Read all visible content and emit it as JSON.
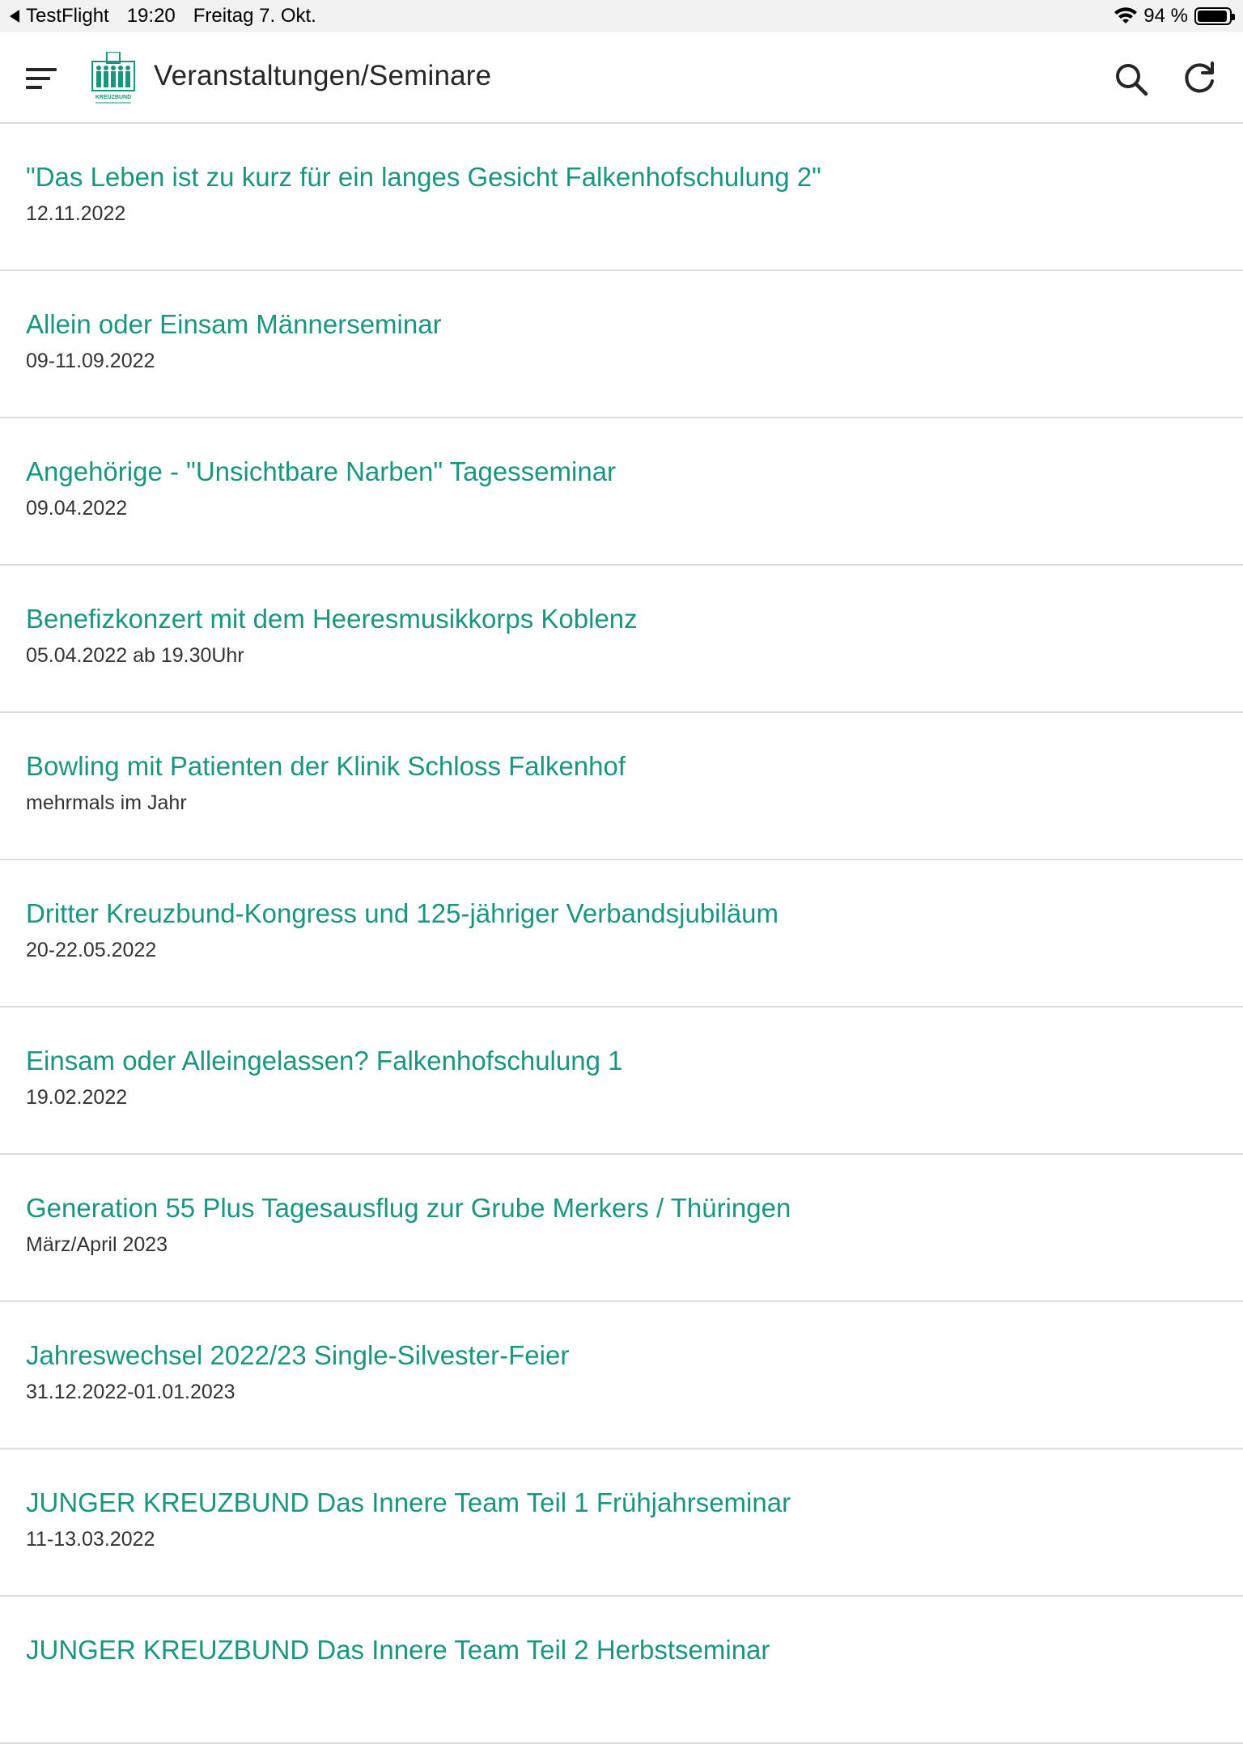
{
  "status_bar": {
    "app": "TestFlight",
    "time": "19:20",
    "date": "Freitag 7. Okt.",
    "battery": "94 %",
    "battery_level": 0.94
  },
  "app_bar": {
    "title": "Veranstaltungen/Seminare",
    "logo_text": "KREUZBUND"
  },
  "colors": {
    "accent": "#1a9680",
    "divider": "#dcdcdc",
    "text_secondary": "#333333"
  },
  "icons": {
    "menu": "menu-icon",
    "search": "search-icon",
    "refresh": "refresh-icon",
    "logo": "kreuzbund-logo"
  },
  "events": [
    {
      "title": "\"Das Leben ist zu kurz für ein langes Gesicht Falkenhofschulung 2\"",
      "date": "12.11.2022"
    },
    {
      "title": "Allein oder Einsam Männerseminar",
      "date": "09-11.09.2022"
    },
    {
      "title": "Angehörige - \"Unsichtbare Narben\" Tagesseminar",
      "date": "09.04.2022"
    },
    {
      "title": "Benefizkonzert mit dem Heeresmusikkorps Koblenz",
      "date": "05.04.2022 ab 19.30Uhr"
    },
    {
      "title": "Bowling mit Patienten der Klinik Schloss Falkenhof",
      "date": "mehrmals im Jahr"
    },
    {
      "title": "Dritter Kreuzbund-Kongress und 125-jähriger Verbandsjubiläum",
      "date": "20-22.05.2022"
    },
    {
      "title": "Einsam oder Alleingelassen? Falkenhofschulung 1",
      "date": "19.02.2022"
    },
    {
      "title": "Generation 55 Plus Tagesausflug zur Grube Merkers / Thüringen",
      "date": "März/April 2023"
    },
    {
      "title": "Jahreswechsel 2022/23 Single-Silvester-Feier",
      "date": "31.12.2022-01.01.2023"
    },
    {
      "title": "JUNGER KREUZBUND Das Innere Team Teil 1 Frühjahrseminar",
      "date": "11-13.03.2022"
    },
    {
      "title": "JUNGER KREUZBUND Das Innere Team Teil 2 Herbstseminar",
      "date": ""
    }
  ]
}
